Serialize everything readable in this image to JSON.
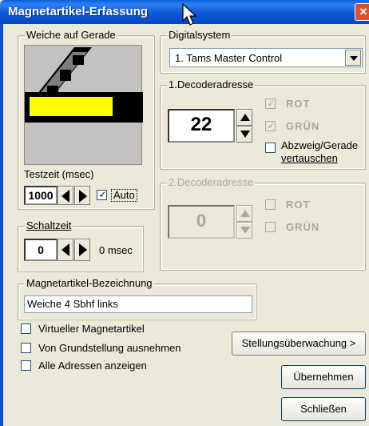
{
  "window": {
    "title": "Magnetartikel-Erfassung",
    "close_glyph": "✕"
  },
  "weiche_group": {
    "legend": "Weiche auf Gerade",
    "testzeit_label": "Testzeit (msec)",
    "testzeit_value": "1000",
    "auto_label": "Auto",
    "auto_checked": true
  },
  "schaltzeit_group": {
    "legend": "Schaltzeit",
    "value": "0",
    "unit": "0 msec"
  },
  "digitalsystem_group": {
    "legend": "Digitalsystem",
    "selected": "1. Tams Master Control"
  },
  "decoder1": {
    "legend": "1.Decoderadresse",
    "value": "22",
    "rot_label": "ROT",
    "rot_checked": true,
    "gruen_label": "GRÜN",
    "gruen_checked": true,
    "swap_line1": "Abzweig/Gerade",
    "swap_line2": "vertauschen",
    "swap_checked": false
  },
  "decoder2": {
    "legend": "2.Decoderadresse",
    "value": "0",
    "rot_label": "ROT",
    "gruen_label": "GRÜN"
  },
  "bezeichnung_group": {
    "legend": "Magnetartikel-Bezeichnung",
    "value": "Weiche 4 Sbhf links"
  },
  "options": {
    "virtuell": "Virtueller Magnetartikel",
    "grundstellung": "Von Grundstellung ausnehmen",
    "alle_adressen": "Alle Adressen anzeigen"
  },
  "buttons": {
    "stellung": "Stellungsüberwachung >",
    "uebernehmen": "Übernehmen",
    "schliessen": "Schließen"
  },
  "colors": {
    "titlebar": "#0a5fdc",
    "track_yellow": "#ffff00",
    "track_black": "#000000",
    "track_gray": "#8a8a8a"
  }
}
